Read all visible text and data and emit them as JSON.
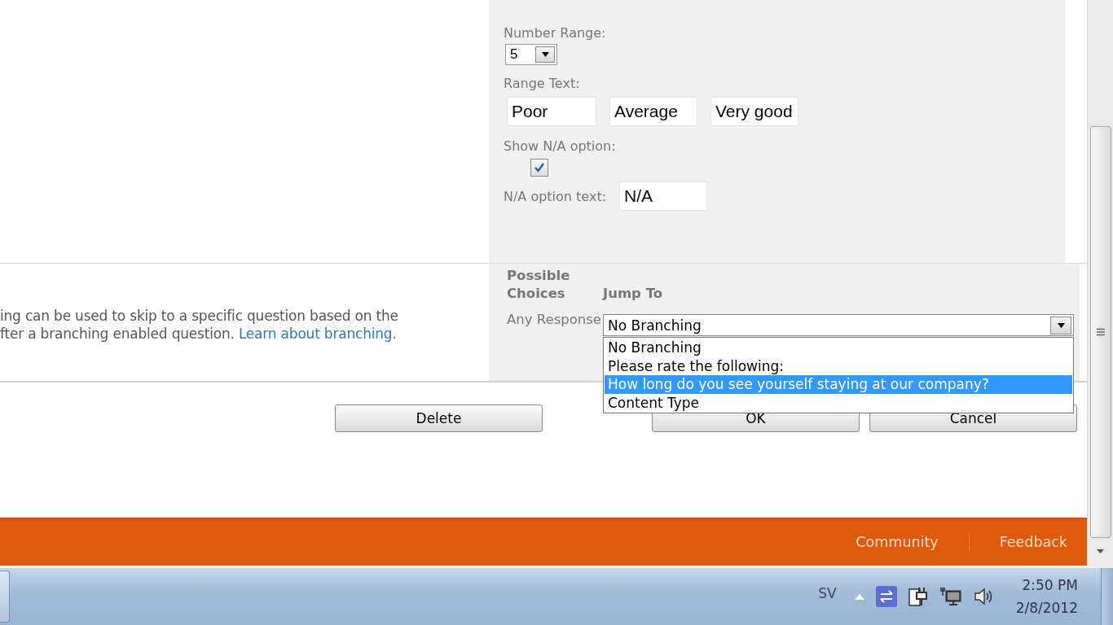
{
  "rating_settings": {
    "number_range": {
      "label": "Number Range:",
      "value": "5"
    },
    "range_text": {
      "label": "Range Text:",
      "values": [
        "Poor",
        "Average",
        "Very good"
      ]
    },
    "show_na": {
      "label": "Show N/A option:",
      "checked": true
    },
    "na_text": {
      "label": "N/A option text:",
      "value": "N/A"
    }
  },
  "branching": {
    "description_lines": [
      "ing can be used to skip to a specific question based on the",
      "fter a branching enabled question."
    ],
    "link": "Learn about branching.",
    "columns": [
      "Possible Choices",
      "Jump To"
    ],
    "row": {
      "label": "Any Response",
      "value": "No Branching",
      "expanded": true,
      "options": [
        {
          "label": "No Branching",
          "highlighted": false
        },
        {
          "label": "Please rate the following:",
          "highlighted": false
        },
        {
          "label": "How long do you see yourself staying at our company?",
          "highlighted": true
        },
        {
          "label": "Content Type",
          "highlighted": false
        }
      ]
    }
  },
  "buttons": [
    "Delete",
    "OK",
    "Cancel"
  ],
  "footer": {
    "links": [
      "Community",
      "Feedback"
    ]
  },
  "taskbar": {
    "language": "SV",
    "time": "2:50 PM",
    "date": "2/8/2012"
  }
}
